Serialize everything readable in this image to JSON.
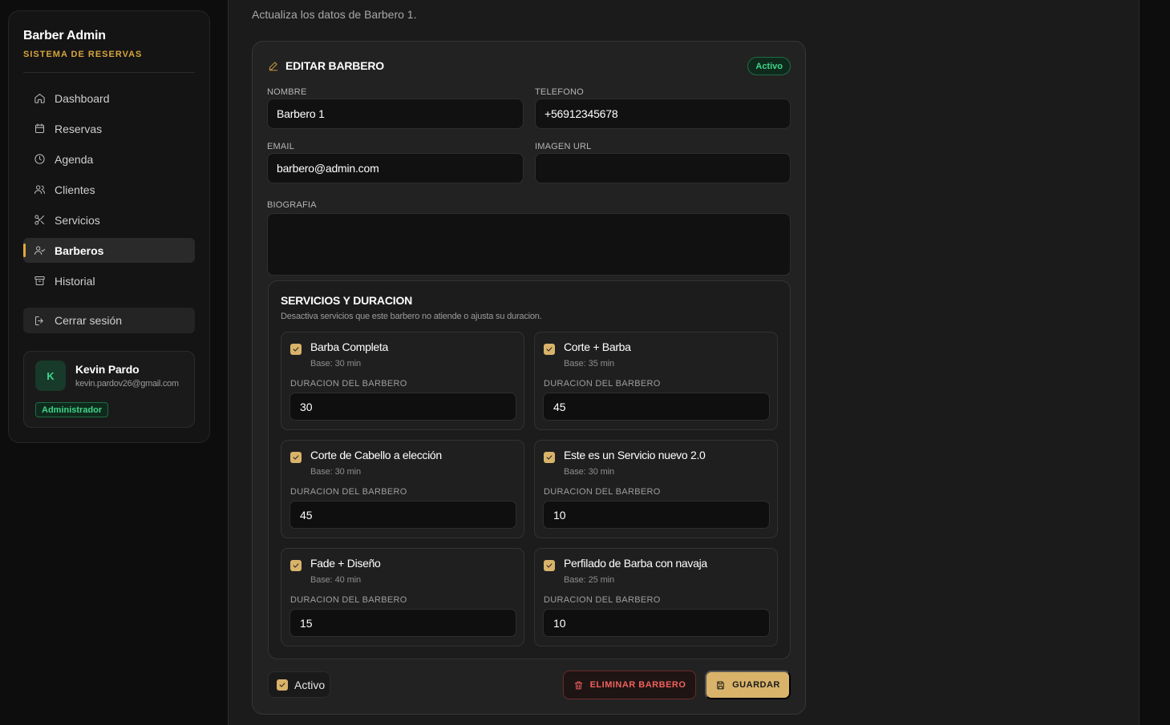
{
  "sidebar": {
    "brand_title": "Barber Admin",
    "brand_subtitle": "SISTEMA DE RESERVAS",
    "accent_color": "#d6a53e",
    "items": [
      {
        "label": "Dashboard",
        "icon": "home-icon"
      },
      {
        "label": "Reservas",
        "icon": "calendar-icon"
      },
      {
        "label": "Agenda",
        "icon": "clock-icon"
      },
      {
        "label": "Clientes",
        "icon": "users-icon"
      },
      {
        "label": "Servicios",
        "icon": "scissors-icon"
      },
      {
        "label": "Barberos",
        "icon": "user-check-icon",
        "active": true
      },
      {
        "label": "Historial",
        "icon": "archive-icon"
      }
    ],
    "logout_label": "Cerrar sesión",
    "user": {
      "initial": "K",
      "name": "Kevin Pardo",
      "email": "kevin.pardov26@gmail.com",
      "role": "Administrador"
    }
  },
  "main": {
    "subtitle": "Actualiza los datos de Barbero 1.",
    "form": {
      "title": "EDITAR BARBERO",
      "status": "Activo",
      "fields": {
        "nombre_label": "NOMBRE",
        "nombre_value": "Barbero 1",
        "telefono_label": "TELEFONO",
        "telefono_value": "+56912345678",
        "email_label": "EMAIL",
        "email_value": "barbero@admin.com",
        "imagen_label": "IMAGEN URL",
        "imagen_value": "",
        "biografia_label": "BIOGRAFIA",
        "biografia_value": ""
      },
      "services": {
        "title": "SERVICIOS Y DURACION",
        "description": "Desactiva servicios que este barbero no atiende o ajusta su duracion.",
        "duration_label": "DURACION DEL BARBERO",
        "items": [
          {
            "name": "Barba Completa",
            "base": "Base: 30 min",
            "duration": "30",
            "checked": true
          },
          {
            "name": "Corte + Barba",
            "base": "Base: 35 min",
            "duration": "45",
            "checked": true
          },
          {
            "name": "Corte de Cabello a elección",
            "base": "Base: 30 min",
            "duration": "45",
            "checked": true
          },
          {
            "name": "Este es un Servicio nuevo 2.0",
            "base": "Base: 30 min",
            "duration": "10",
            "checked": true
          },
          {
            "name": "Fade + Diseño",
            "base": "Base: 40 min",
            "duration": "15",
            "checked": true
          },
          {
            "name": "Perfilado de Barba con navaja",
            "base": "Base: 25 min",
            "duration": "10",
            "checked": true
          }
        ]
      },
      "active_label": "Activo",
      "delete_label": "ELIMINAR BARBERO",
      "save_label": "GUARDAR"
    }
  }
}
